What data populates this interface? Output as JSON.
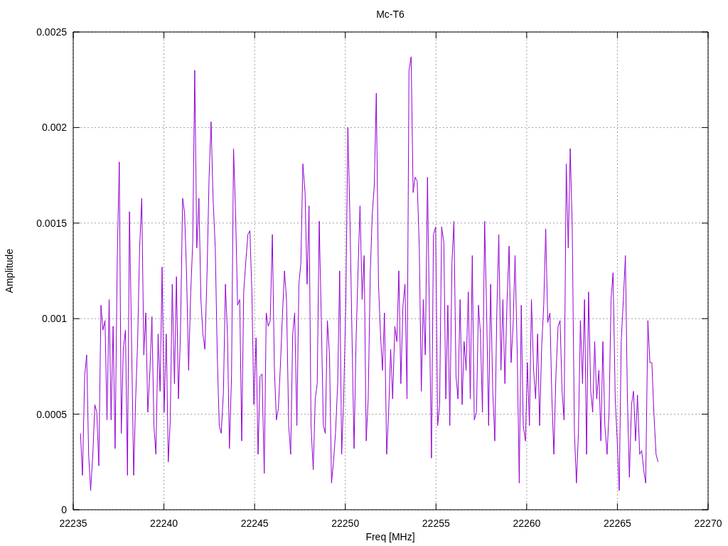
{
  "chart_data": {
    "type": "line",
    "grid": true,
    "title": "Mc-T6",
    "xlabel": "Freq [MHz]",
    "ylabel": "Amplitude",
    "xlim": [
      22235,
      22270
    ],
    "ylim": [
      0,
      0.0025
    ],
    "xticks": [
      22235,
      22240,
      22245,
      22250,
      22255,
      22260,
      22265,
      22270
    ],
    "yticks": [
      0,
      0.0005,
      0.001,
      0.0015,
      0.002,
      0.0025
    ],
    "x": [
      22235.4,
      22235.51,
      22235.63,
      22235.74,
      22235.85,
      22235.96,
      22236.08,
      22236.19,
      22236.3,
      22236.41,
      22236.53,
      22236.64,
      22236.75,
      22236.86,
      22236.98,
      22237.09,
      22237.2,
      22237.31,
      22237.43,
      22237.54,
      22237.65,
      22237.76,
      22237.88,
      22237.99,
      22238.1,
      22238.21,
      22238.33,
      22238.44,
      22238.55,
      22238.66,
      22238.78,
      22238.89,
      22239.0,
      22239.11,
      22239.23,
      22239.34,
      22239.45,
      22239.56,
      22239.68,
      22239.79,
      22239.9,
      22240.01,
      22240.13,
      22240.24,
      22240.35,
      22240.46,
      22240.58,
      22240.69,
      22240.8,
      22240.91,
      22241.03,
      22241.14,
      22241.25,
      22241.36,
      22241.48,
      22241.59,
      22241.7,
      22241.81,
      22241.93,
      22242.04,
      22242.15,
      22242.26,
      22242.38,
      22242.49,
      22242.6,
      22242.71,
      22242.83,
      22242.94,
      22243.05,
      22243.16,
      22243.28,
      22243.39,
      22243.5,
      22243.61,
      22243.73,
      22243.84,
      22243.95,
      22244.06,
      22244.18,
      22244.29,
      22244.4,
      22244.51,
      22244.63,
      22244.74,
      22244.85,
      22244.96,
      22245.08,
      22245.19,
      22245.3,
      22245.41,
      22245.53,
      22245.64,
      22245.75,
      22245.86,
      22245.98,
      22246.09,
      22246.2,
      22246.31,
      22246.43,
      22246.54,
      22246.65,
      22246.76,
      22246.88,
      22246.99,
      22247.1,
      22247.21,
      22247.33,
      22247.44,
      22247.55,
      22247.66,
      22247.78,
      22247.89,
      22248.0,
      22248.11,
      22248.23,
      22248.34,
      22248.45,
      22248.56,
      22248.68,
      22248.79,
      22248.9,
      22249.01,
      22249.13,
      22249.24,
      22249.35,
      22249.46,
      22249.58,
      22249.69,
      22249.8,
      22249.91,
      22250.03,
      22250.14,
      22250.25,
      22250.36,
      22250.48,
      22250.59,
      22250.7,
      22250.81,
      22250.93,
      22251.04,
      22251.15,
      22251.26,
      22251.38,
      22251.49,
      22251.6,
      22251.71,
      22251.83,
      22251.94,
      22252.05,
      22252.16,
      22252.28,
      22252.39,
      22252.5,
      22252.61,
      22252.73,
      22252.84,
      22252.95,
      22253.06,
      22253.18,
      22253.29,
      22253.4,
      22253.51,
      22253.63,
      22253.74,
      22253.85,
      22253.96,
      22254.08,
      22254.19,
      22254.3,
      22254.41,
      22254.53,
      22254.64,
      22254.75,
      22254.86,
      22254.98,
      22255.09,
      22255.2,
      22255.31,
      22255.43,
      22255.54,
      22255.65,
      22255.76,
      22255.88,
      22255.99,
      22256.1,
      22256.21,
      22256.33,
      22256.44,
      22256.55,
      22256.66,
      22256.78,
      22256.89,
      22257.0,
      22257.11,
      22257.23,
      22257.34,
      22257.45,
      22257.56,
      22257.68,
      22257.79,
      22257.9,
      22258.01,
      22258.13,
      22258.24,
      22258.35,
      22258.46,
      22258.58,
      22258.69,
      22258.8,
      22258.91,
      22259.03,
      22259.14,
      22259.25,
      22259.36,
      22259.48,
      22259.59,
      22259.7,
      22259.81,
      22259.93,
      22260.04,
      22260.15,
      22260.26,
      22260.38,
      22260.49,
      22260.6,
      22260.71,
      22260.83,
      22260.94,
      22261.05,
      22261.16,
      22261.28,
      22261.39,
      22261.5,
      22261.61,
      22261.73,
      22261.84,
      22261.95,
      22262.06,
      22262.18,
      22262.29,
      22262.4,
      22262.51,
      22262.63,
      22262.74,
      22262.85,
      22262.96,
      22263.08,
      22263.19,
      22263.3,
      22263.41,
      22263.53,
      22263.64,
      22263.75,
      22263.86,
      22263.98,
      22264.09,
      22264.2,
      22264.31,
      22264.43,
      22264.54,
      22264.65,
      22264.76,
      22264.88,
      22264.99,
      22265.1,
      22265.21,
      22265.33,
      22265.44,
      22265.55,
      22265.66,
      22265.78,
      22265.89,
      22266.0,
      22266.11,
      22266.23,
      22266.34,
      22266.45,
      22266.56,
      22266.68,
      22266.79,
      22266.9,
      22267.01,
      22267.13,
      22267.24
    ],
    "series": [
      {
        "color": "#9400d3",
        "values": [
          0.0004,
          0.00018,
          0.0007,
          0.00081,
          0.00029,
          0.0001,
          0.00029,
          0.00055,
          0.00051,
          0.00023,
          0.00107,
          0.00094,
          0.00099,
          0.00047,
          0.0011,
          0.00047,
          0.00096,
          0.00032,
          0.00133,
          0.00182,
          0.0004,
          0.00084,
          0.00094,
          0.00018,
          0.00156,
          0.00092,
          0.00018,
          0.00058,
          0.00088,
          0.00137,
          0.00163,
          0.00081,
          0.00103,
          0.00051,
          0.00073,
          0.00101,
          0.00044,
          0.00029,
          0.00092,
          0.00062,
          0.00127,
          0.00051,
          0.00092,
          0.00025,
          0.00047,
          0.00118,
          0.00066,
          0.00122,
          0.00058,
          0.00092,
          0.00163,
          0.00155,
          0.00122,
          0.00073,
          0.00114,
          0.0014,
          0.0023,
          0.00137,
          0.00163,
          0.0011,
          0.00092,
          0.00084,
          0.00125,
          0.00174,
          0.00203,
          0.00163,
          0.00137,
          0.00081,
          0.00044,
          0.0004,
          0.00062,
          0.00118,
          0.00092,
          0.00032,
          0.0007,
          0.00189,
          0.00155,
          0.00107,
          0.0011,
          0.00036,
          0.00114,
          0.00129,
          0.00144,
          0.00146,
          0.00114,
          0.00055,
          0.0009,
          0.00029,
          0.0007,
          0.00071,
          0.00019,
          0.00103,
          0.00096,
          0.00099,
          0.00144,
          0.00073,
          0.00047,
          0.00053,
          0.00077,
          0.00103,
          0.00125,
          0.0011,
          0.00044,
          0.00029,
          0.00092,
          0.00103,
          0.00044,
          0.00118,
          0.00129,
          0.00181,
          0.00166,
          0.00118,
          0.00159,
          0.00044,
          0.00021,
          0.00058,
          0.00066,
          0.00151,
          0.00099,
          0.00044,
          0.0004,
          0.00099,
          0.00081,
          0.00014,
          0.00025,
          0.0004,
          0.00066,
          0.00125,
          0.00029,
          0.00058,
          0.0011,
          0.002,
          0.00155,
          0.00096,
          0.00032,
          0.00088,
          0.00125,
          0.00159,
          0.0011,
          0.00133,
          0.00036,
          0.00058,
          0.00125,
          0.00155,
          0.0017,
          0.00218,
          0.00118,
          0.00092,
          0.00073,
          0.00103,
          0.00029,
          0.00051,
          0.00084,
          0.00058,
          0.00096,
          0.00088,
          0.00125,
          0.00066,
          0.00107,
          0.00118,
          0.00058,
          0.0023,
          0.00237,
          0.00166,
          0.00174,
          0.00172,
          0.00137,
          0.00062,
          0.0011,
          0.00081,
          0.00174,
          0.00099,
          0.00027,
          0.00144,
          0.00148,
          0.00044,
          0.00055,
          0.00148,
          0.0014,
          0.00058,
          0.00107,
          0.00044,
          0.00129,
          0.00151,
          0.0007,
          0.00058,
          0.0011,
          0.00055,
          0.00088,
          0.00073,
          0.00114,
          0.00058,
          0.00133,
          0.00047,
          0.00051,
          0.00107,
          0.00092,
          0.00051,
          0.00151,
          0.00103,
          0.00044,
          0.00118,
          0.00062,
          0.00036,
          0.00103,
          0.00144,
          0.00073,
          0.0011,
          0.00066,
          0.00107,
          0.00138,
          0.00077,
          0.00096,
          0.00133,
          0.00081,
          0.00014,
          0.00107,
          0.00044,
          0.00036,
          0.00077,
          0.00044,
          0.0011,
          0.00073,
          0.00058,
          0.00092,
          0.00044,
          0.00086,
          0.00107,
          0.00147,
          0.00098,
          0.00103,
          0.00058,
          0.00029,
          0.0007,
          0.00096,
          0.00099,
          0.00062,
          0.00047,
          0.00181,
          0.00137,
          0.00189,
          0.00148,
          0.0004,
          0.00014,
          0.0004,
          0.00099,
          0.00066,
          0.0011,
          0.00029,
          0.00114,
          0.00062,
          0.00051,
          0.00088,
          0.00058,
          0.00073,
          0.00036,
          0.00088,
          0.00044,
          0.00029,
          0.00051,
          0.0011,
          0.00124,
          0.00058,
          0.00036,
          0.0001,
          0.00088,
          0.0011,
          0.00133,
          0.00058,
          0.00017,
          0.00055,
          0.00062,
          0.00036,
          0.0006,
          0.00029,
          0.00031,
          0.00021,
          0.00014,
          0.00099,
          0.00077,
          0.00077,
          0.00051,
          0.00029,
          0.00025
        ]
      }
    ]
  }
}
